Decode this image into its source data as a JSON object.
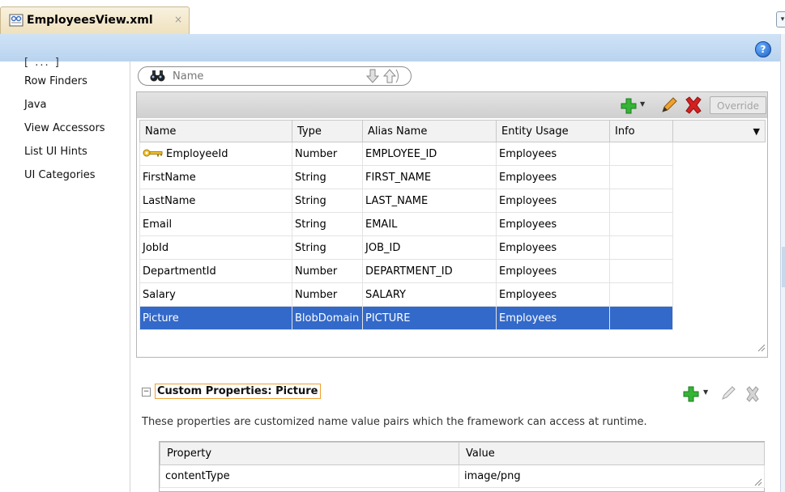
{
  "editor_tab": {
    "title": "EmployeesView.xml",
    "close_glyph": "×",
    "icon": "view-object-xml-file-icon"
  },
  "header": {
    "help_glyph": "?",
    "tab_menu_glyph": "▾"
  },
  "left_nav": {
    "clipped_label": "[ ... ]",
    "items": [
      {
        "label": "Row Finders"
      },
      {
        "label": "Java"
      },
      {
        "label": "View Accessors"
      },
      {
        "label": "List UI Hints"
      },
      {
        "label": "UI Categories"
      }
    ]
  },
  "search": {
    "placeholder": "Name",
    "value": ""
  },
  "attributes": {
    "toolbar": {
      "override_label": "Override"
    },
    "columns": [
      "Name",
      "Type",
      "Alias Name",
      "Entity Usage",
      "Info"
    ],
    "rows": [
      {
        "name": "EmployeeId",
        "type": "Number",
        "alias": "EMPLOYEE_ID",
        "entity_usage": "Employees",
        "info": "",
        "key": true
      },
      {
        "name": "FirstName",
        "type": "String",
        "alias": "FIRST_NAME",
        "entity_usage": "Employees",
        "info": ""
      },
      {
        "name": "LastName",
        "type": "String",
        "alias": "LAST_NAME",
        "entity_usage": "Employees",
        "info": ""
      },
      {
        "name": "Email",
        "type": "String",
        "alias": "EMAIL",
        "entity_usage": "Employees",
        "info": ""
      },
      {
        "name": "JobId",
        "type": "String",
        "alias": "JOB_ID",
        "entity_usage": "Employees",
        "info": ""
      },
      {
        "name": "DepartmentId",
        "type": "Number",
        "alias": "DEPARTMENT_ID",
        "entity_usage": "Employees",
        "info": ""
      },
      {
        "name": "Salary",
        "type": "Number",
        "alias": "SALARY",
        "entity_usage": "Employees",
        "info": ""
      },
      {
        "name": "Picture",
        "type": "BlobDomain",
        "alias": "PICTURE",
        "entity_usage": "Employees",
        "info": "",
        "selected": true
      }
    ]
  },
  "custom_properties": {
    "title": "Custom Properties: Picture",
    "collapse_glyph": "−",
    "description": "These properties are customized name value pairs which the framework can access at runtime.",
    "columns": [
      "Property",
      "Value"
    ],
    "rows": [
      {
        "property": "contentType",
        "value": "image/png"
      }
    ]
  },
  "colors": {
    "selection": "#3369c9",
    "header_band": "#cfe3f6",
    "accent_orange": "#f0a030",
    "add_green": "#2ea82e",
    "delete_red": "#d42020"
  }
}
